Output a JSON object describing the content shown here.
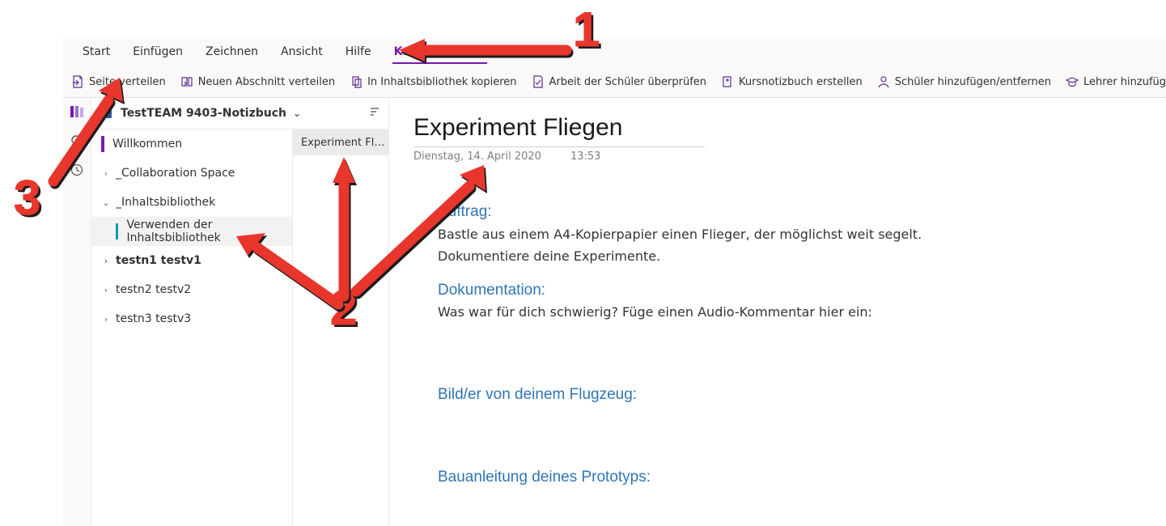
{
  "tabs": {
    "items": [
      {
        "label": "Start"
      },
      {
        "label": "Einfügen"
      },
      {
        "label": "Zeichnen"
      },
      {
        "label": "Ansicht"
      },
      {
        "label": "Hilfe"
      },
      {
        "label": "Kursnotizbuch",
        "active": true
      }
    ]
  },
  "ribbon": {
    "items": [
      {
        "label": "Seite verteilen"
      },
      {
        "label": "Neuen Abschnitt verteilen"
      },
      {
        "label": "In Inhaltsbibliothek kopieren"
      },
      {
        "label": "Arbeit der Schüler überprüfen"
      },
      {
        "label": "Kursnotizbuch erstellen"
      },
      {
        "label": "Schüler hinzufügen/entfernen"
      },
      {
        "label": "Lehrer hinzufügen/entfernen"
      }
    ]
  },
  "notebook": {
    "title": "TestTEAM 9403-Notizbuch"
  },
  "sections": [
    {
      "kind": "bar",
      "color": "purple",
      "label": "Willkommen"
    },
    {
      "kind": "expand",
      "chev": "›",
      "label": "_Collaboration Space"
    },
    {
      "kind": "expand",
      "chev": "⌄",
      "label": "_Inhaltsbibliothek"
    },
    {
      "kind": "child-bar",
      "color": "cyan",
      "label": "Verwenden der Inhaltsbibliothek",
      "selected": true
    },
    {
      "kind": "expand",
      "chev": "›",
      "label": "testn1 testv1",
      "bold": true
    },
    {
      "kind": "expand",
      "chev": "›",
      "label": "testn2 testv2"
    },
    {
      "kind": "expand",
      "chev": "›",
      "label": "testn3 testv3"
    }
  ],
  "pageList": [
    {
      "label": "Experiment Fl…",
      "selected": true
    }
  ],
  "page": {
    "title": "Experiment Fliegen",
    "date": "Dienstag, 14. April 2020",
    "time": "13:53",
    "heading_auftrag": "Auftrag:",
    "auftrag_l1": "Bastle aus einem A4-Kopierpapier einen Flieger, der möglichst weit segelt.",
    "auftrag_l2": "Dokumentiere deine Experimente.",
    "heading_doku": "Dokumentation:",
    "doku_l1": "Was war für dich schwierig? Füge einen Audio-Kommentar hier ein:",
    "heading_bild": "Bild/er von deinem Flugzeug:",
    "heading_bau": "Bauanleitung deines Prototyps:"
  },
  "annotations": {
    "one": "1",
    "two": "2",
    "three": "3"
  }
}
